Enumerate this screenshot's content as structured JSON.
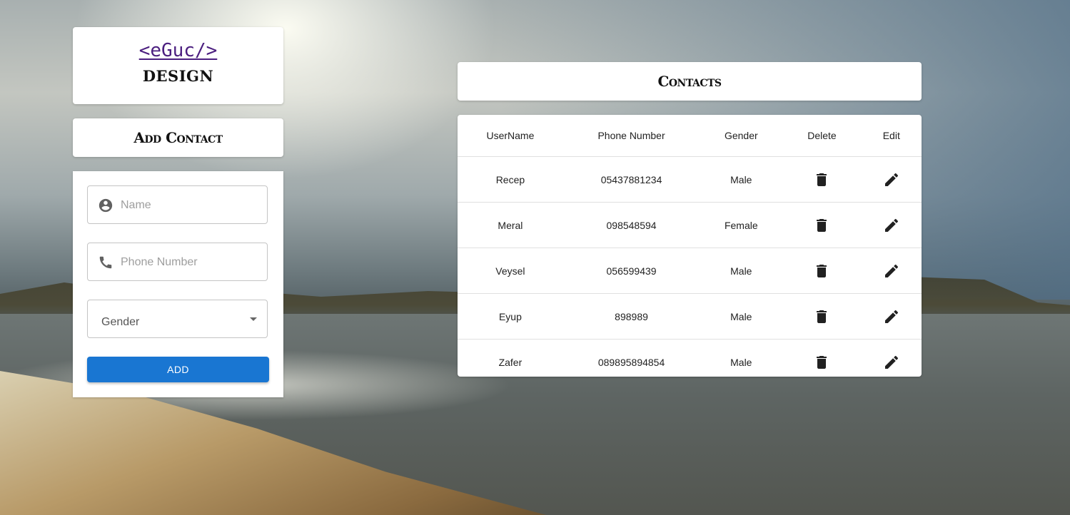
{
  "logo": {
    "code": "<eGuc/>",
    "subtitle": "DESIGN"
  },
  "add_contact": {
    "title": "Add Contact",
    "name_placeholder": "Name",
    "phone_placeholder": "Phone Number",
    "gender_label": "Gender",
    "add_button": "ADD"
  },
  "contacts": {
    "title": "Contacts",
    "columns": [
      "UserName",
      "Phone Number",
      "Gender",
      "Delete",
      "Edit"
    ],
    "rows": [
      {
        "username": "Recep",
        "phone": "05437881234",
        "gender": "Male"
      },
      {
        "username": "Meral",
        "phone": "098548594",
        "gender": "Female"
      },
      {
        "username": "Veysel",
        "phone": "056599439",
        "gender": "Male"
      },
      {
        "username": "Eyup",
        "phone": "898989",
        "gender": "Male"
      },
      {
        "username": "Zafer",
        "phone": "089895894854",
        "gender": "Male"
      }
    ]
  },
  "colors": {
    "primary": "#1976d2",
    "logo": "#4b1e7f"
  },
  "icons": {
    "name_field": "account-circle-icon",
    "phone_field": "phone-icon",
    "delete": "trash-icon",
    "edit": "pencil-icon",
    "select": "caret-down-icon"
  }
}
